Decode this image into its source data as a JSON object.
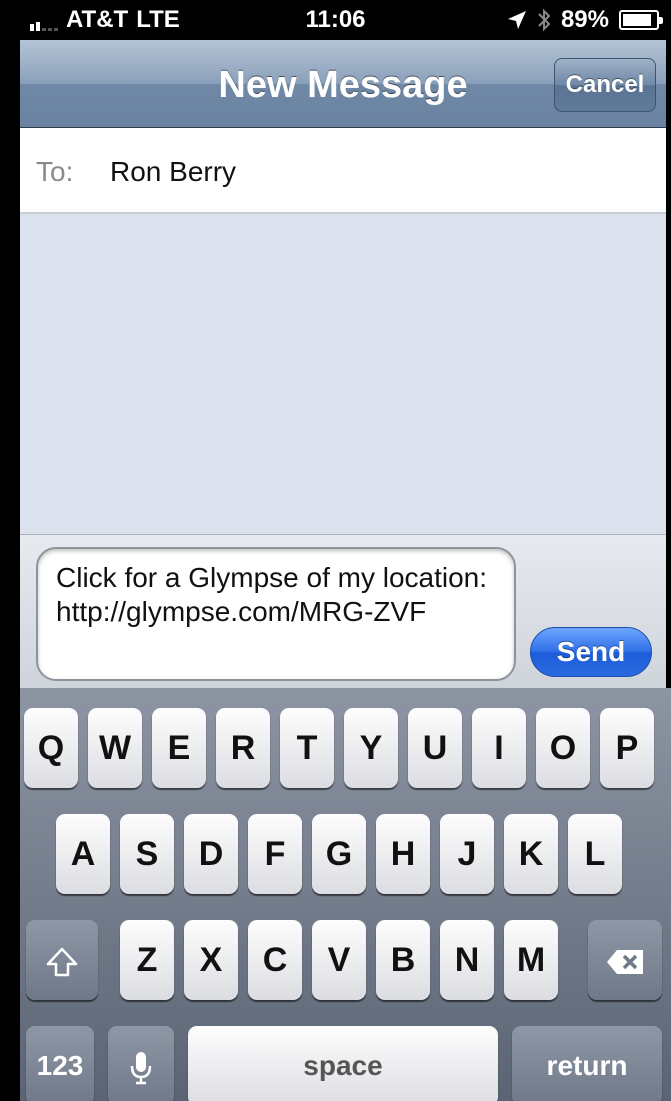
{
  "status_bar": {
    "carrier": "AT&T",
    "network": "LTE",
    "time": "11:06",
    "battery": "89%",
    "battery_level": 0.89
  },
  "nav": {
    "title": "New Message",
    "cancel_label": "Cancel"
  },
  "compose": {
    "to_label": "To:",
    "to_value": "Ron Berry",
    "message_text": "Click for a Glympse of my location: http://glympse.com/MRG-ZVF",
    "send_label": "Send"
  },
  "keyboard": {
    "row1": [
      "Q",
      "W",
      "E",
      "R",
      "T",
      "Y",
      "U",
      "I",
      "O",
      "P"
    ],
    "row2": [
      "A",
      "S",
      "D",
      "F",
      "G",
      "H",
      "J",
      "K",
      "L"
    ],
    "row3": [
      "Z",
      "X",
      "C",
      "V",
      "B",
      "N",
      "M"
    ],
    "numbers_label": "123",
    "space_label": "space",
    "return_label": "return"
  },
  "colors": {
    "send_blue": "#2f6fe6",
    "nav_blue": "#6f88a6",
    "message_bg": "#dbe2ed"
  }
}
